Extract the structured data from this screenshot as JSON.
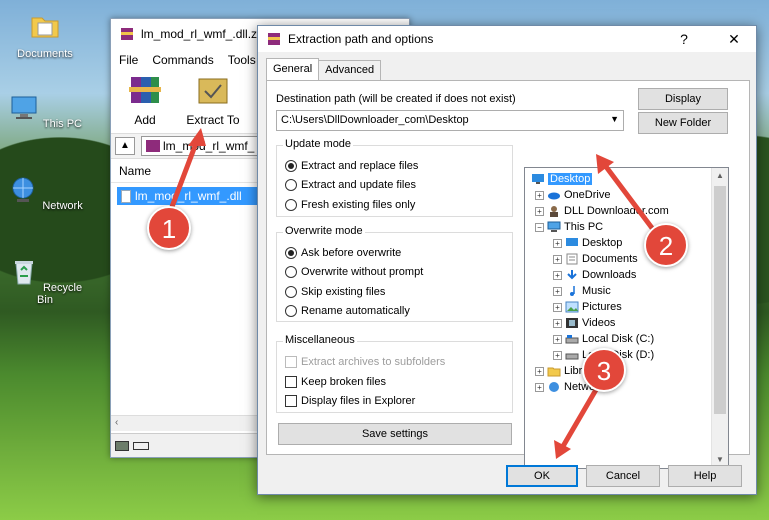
{
  "desktop": {
    "icons": [
      {
        "label": "Documents"
      },
      {
        "label": "This PC"
      },
      {
        "label": "Network"
      },
      {
        "label": "Recycle Bin"
      }
    ]
  },
  "winrar": {
    "title": "lm_mod_rl_wmf_.dll.z",
    "menu": [
      "File",
      "Commands",
      "Tools"
    ],
    "tools": {
      "add": "Add",
      "extract_to": "Extract To"
    },
    "path_box": "lm_mod_rl_wmf_",
    "column_name": "Name",
    "file_row": "lm_mod_rl_wmf_.dll"
  },
  "dialog": {
    "title": "Extraction path and options",
    "help_glyph": "?",
    "close_glyph": "✕",
    "tabs": [
      "General",
      "Advanced"
    ],
    "destination_label": "Destination path (will be created if does not exist)",
    "destination_value": "C:\\Users\\DllDownloader_com\\Desktop",
    "display_button": "Display",
    "new_folder_button": "New Folder",
    "update_mode": {
      "title": "Update mode",
      "options": [
        "Extract and replace files",
        "Extract and update files",
        "Fresh existing files only"
      ],
      "selected": 0
    },
    "overwrite_mode": {
      "title": "Overwrite mode",
      "options": [
        "Ask before overwrite",
        "Overwrite without prompt",
        "Skip existing files",
        "Rename automatically"
      ],
      "selected": 0
    },
    "misc": {
      "title": "Miscellaneous",
      "options": [
        "Extract archives to subfolders",
        "Keep broken files",
        "Display files in Explorer"
      ]
    },
    "save_settings": "Save settings",
    "tree": [
      {
        "label": "Desktop",
        "selected": true
      },
      {
        "label": "OneDrive"
      },
      {
        "label": "DLL Downloader.com"
      },
      {
        "label": "This PC"
      },
      {
        "label": "Desktop"
      },
      {
        "label": "Documents"
      },
      {
        "label": "Downloads"
      },
      {
        "label": "Music"
      },
      {
        "label": "Pictures"
      },
      {
        "label": "Videos"
      },
      {
        "label": "Local Disk (C:)"
      },
      {
        "label": "Local Disk (D:)"
      },
      {
        "label": "Libraries"
      },
      {
        "label": "Network"
      }
    ],
    "buttons": {
      "ok": "OK",
      "cancel": "Cancel",
      "help": "Help"
    }
  },
  "annotations": [
    "1",
    "2",
    "3"
  ],
  "colors": {
    "accent": "#3399ff",
    "badge": "#e2473a"
  }
}
